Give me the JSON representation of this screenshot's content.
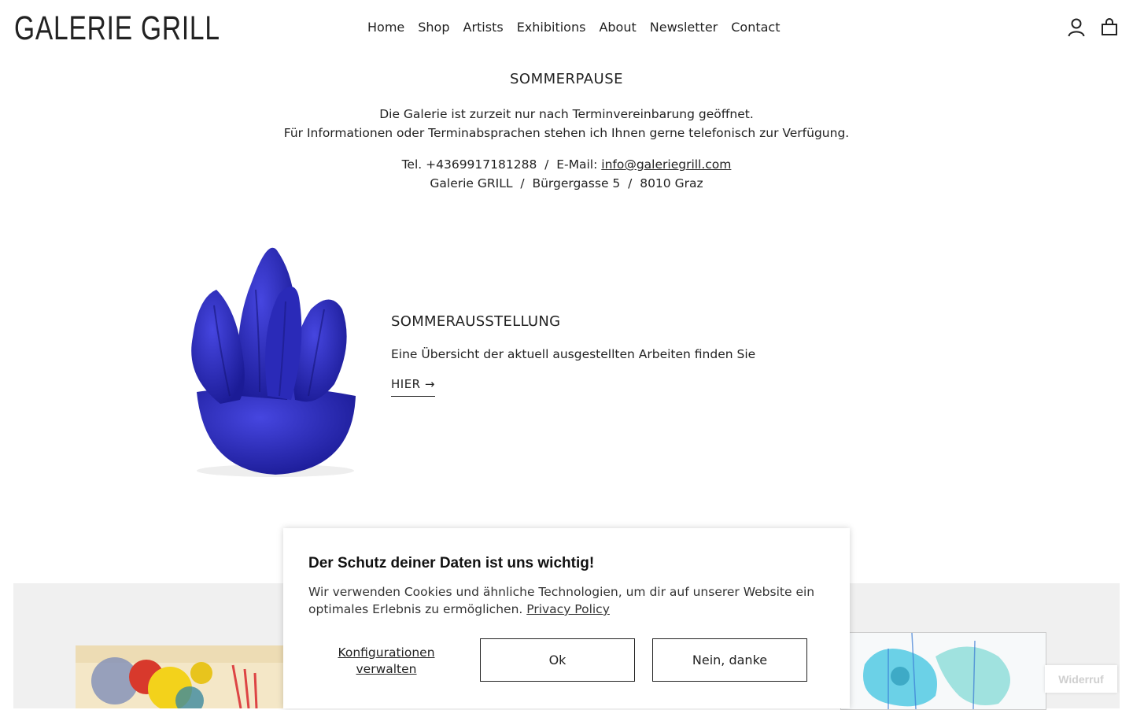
{
  "header": {
    "logo": "GALERIE GRILL",
    "nav": [
      "Home",
      "Shop",
      "Artists",
      "Exhibitions",
      "About",
      "Newsletter",
      "Contact"
    ],
    "icons": [
      "account-icon",
      "cart-icon"
    ]
  },
  "notice": {
    "title": "SOMMERPAUSE",
    "line1": "Die Galerie ist zurzeit nur nach Terminvereinbarung geöffnet.",
    "line2": "Für Informationen oder Terminabsprachen stehen ich Ihnen gerne telefonisch zur Verfügung.",
    "contact_prefix": "Tel. +4369917181288  /  E-Mail: ",
    "email": "info@galeriegrill.com",
    "address": "Galerie GRILL  /  Bürgergasse 5  /  8010 Graz"
  },
  "feature": {
    "title": "SOMMERAUSSTELLUNG",
    "text": "Eine Übersicht der aktuell ausgestellten Arbeiten finden Sie",
    "link": "HIER →"
  },
  "cookie": {
    "title": "Der Schutz deiner Daten ist uns wichtig!",
    "text": "Wir verwenden Cookies und ähnliche Technologien, um dir auf unserer Website ein optimales Erlebnis zu ermöglichen. ",
    "privacy": "Privacy Policy",
    "configure": "Konfigurationen verwalten",
    "ok": "Ok",
    "decline": "Nein, danke"
  },
  "widerruf": "Widerruf",
  "colors": {
    "sculpture": "#2f2fc8",
    "band": "#f0f0f0"
  }
}
